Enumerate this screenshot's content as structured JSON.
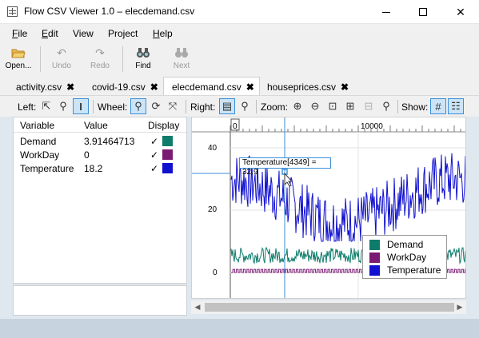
{
  "window": {
    "title": "Flow CSV Viewer 1.0 – elecdemand.csv",
    "min_icon": "minimize-icon",
    "max_icon": "maximize-icon",
    "close_label": "✕"
  },
  "menu": {
    "items": [
      {
        "underline": "F",
        "rest": "ile"
      },
      {
        "underline": "E",
        "rest": "dit"
      },
      {
        "underline": "",
        "rest": "View"
      },
      {
        "underline": "",
        "rest": "Project"
      },
      {
        "underline": "H",
        "rest": "elp"
      }
    ]
  },
  "toolbar": {
    "open_label": "Open...",
    "undo_label": "Undo",
    "redo_label": "Redo",
    "find_label": "Find",
    "next_label": "Next"
  },
  "tabs": [
    {
      "label": "activity.csv",
      "close": "✖"
    },
    {
      "label": "covid-19.csv",
      "close": "✖"
    },
    {
      "label": "elecdemand.csv",
      "close": "✖"
    },
    {
      "label": "houseprices.csv",
      "close": "✖"
    }
  ],
  "controls": {
    "left_label": "Left:",
    "wheel_label": "Wheel:",
    "right_label": "Right:",
    "zoom_label": "Zoom:",
    "show_label": "Show:"
  },
  "variables": {
    "headers": {
      "variable": "Variable",
      "value": "Value",
      "display": "Display"
    },
    "rows": [
      {
        "name": "Demand",
        "value": "3.91464713",
        "checked": "✓",
        "color": "#0e7c6b"
      },
      {
        "name": "WorkDay",
        "value": "0",
        "checked": "✓",
        "color": "#7a1a72"
      },
      {
        "name": "Temperature",
        "value": "18.2",
        "checked": "✓",
        "color": "#1010d0"
      }
    ]
  },
  "chart": {
    "x_ticks": [
      "0",
      "10000"
    ],
    "y_ticks": [
      "40",
      "20",
      "0"
    ],
    "tooltip": "Temperature[4349] = 32.9",
    "legend": [
      {
        "label": "Demand",
        "color": "#0e7c6b"
      },
      {
        "label": "WorkDay",
        "color": "#7a1a72"
      },
      {
        "label": "Temperature",
        "color": "#1010d0"
      }
    ]
  },
  "chart_data": {
    "type": "line",
    "x_ticks": [
      0,
      10000
    ],
    "y_ticks": [
      0,
      20,
      40
    ],
    "ylim": [
      0,
      45
    ],
    "series": [
      {
        "name": "Demand",
        "color": "#0e7c6b",
        "approx_range": [
          3,
          8
        ]
      },
      {
        "name": "WorkDay",
        "color": "#7a1a72",
        "values_set": [
          0,
          1
        ]
      },
      {
        "name": "Temperature",
        "color": "#1010d0",
        "approx_range": [
          10,
          43
        ]
      }
    ],
    "highlight": {
      "series": "Temperature",
      "index": 4349,
      "value": 32.9
    }
  }
}
